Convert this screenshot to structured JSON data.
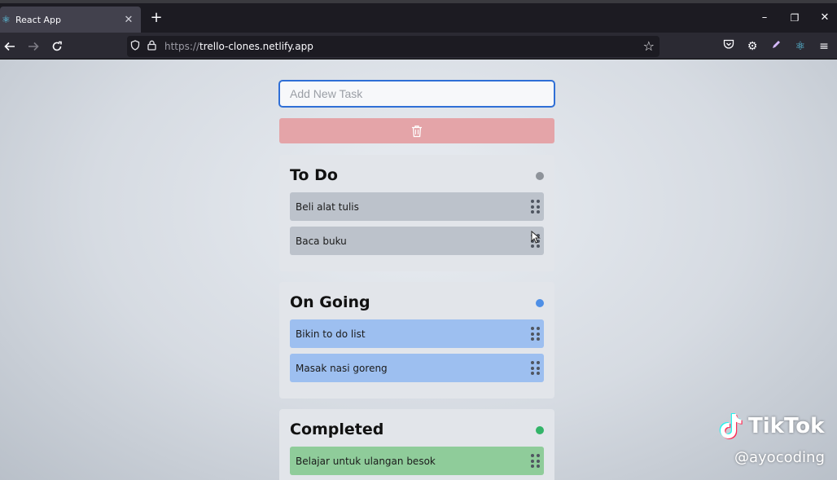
{
  "browser": {
    "tab_title": "React App",
    "tab_close": "✕",
    "new_tab": "+",
    "url_protocol": "https://",
    "url_host": "trello-clones.netlify.app",
    "window_controls": {
      "minimize": "–",
      "restore": "❐",
      "close": "✕"
    }
  },
  "app": {
    "input_placeholder": "Add New Task",
    "trash_icon": "trash-icon",
    "boards": [
      {
        "title": "To Do",
        "dot_color": "#8e939a",
        "card_color": "#bcc2cb",
        "cards": [
          "Beli alat tulis",
          "Baca buku"
        ]
      },
      {
        "title": "On Going",
        "dot_color": "#4e8fe6",
        "card_color": "#9dbff0",
        "cards": [
          "Bikin to do list",
          "Masak nasi goreng"
        ]
      },
      {
        "title": "Completed",
        "dot_color": "#33b469",
        "card_color": "#8fcc9a",
        "cards": [
          "Belajar untuk ulangan besok"
        ]
      }
    ]
  },
  "watermark": {
    "brand": "TikTok",
    "handle": "@ayocoding"
  }
}
